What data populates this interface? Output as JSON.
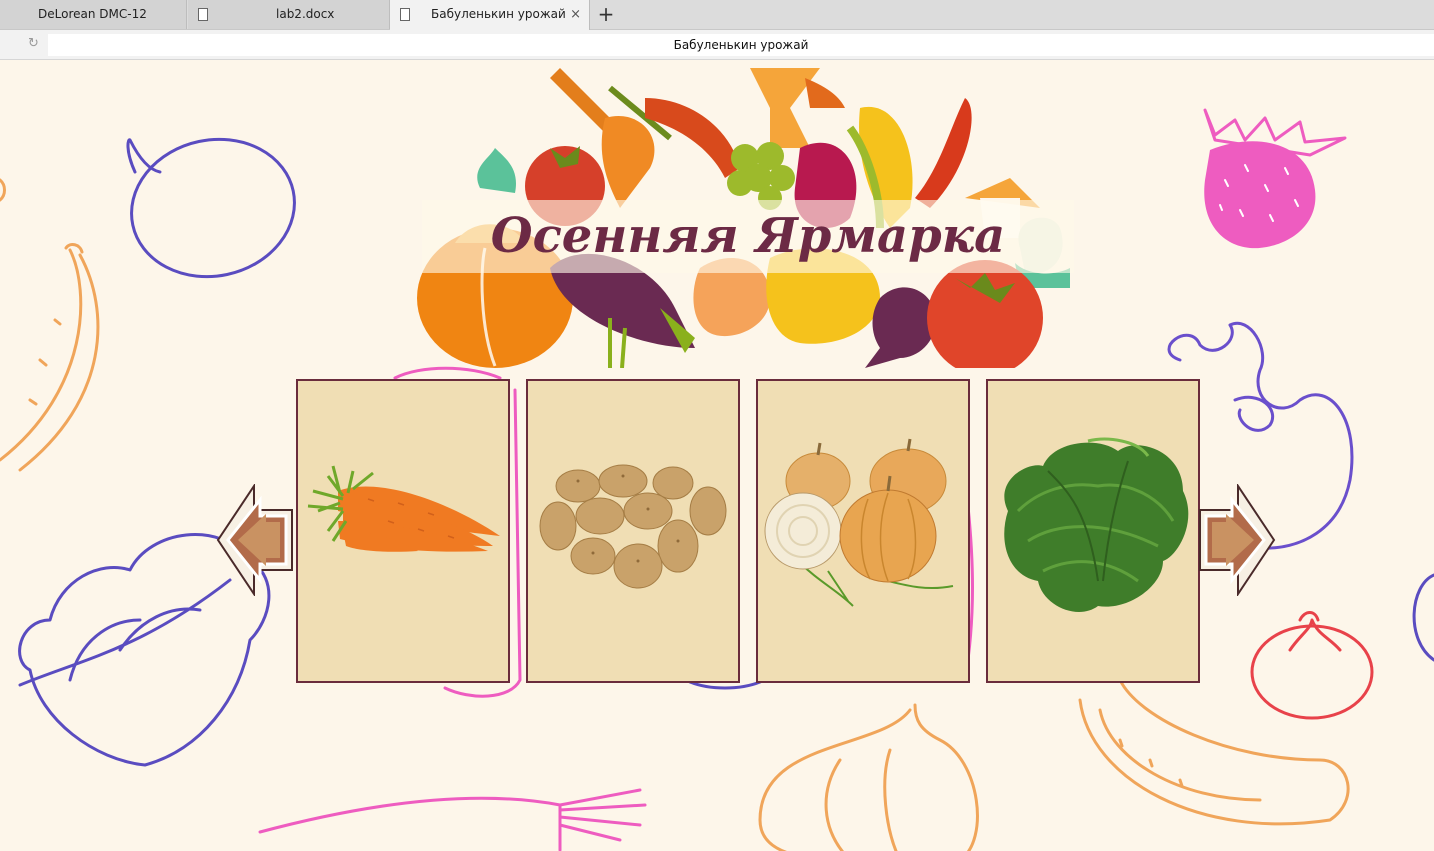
{
  "browser": {
    "tabs": [
      {
        "label": "DeLorean DMC-12",
        "active": false,
        "has_close": false
      },
      {
        "label": "lab2.docx",
        "active": false,
        "has_close": false
      },
      {
        "label": "Бабуленькин урожай",
        "active": true,
        "has_close": true
      }
    ],
    "close_glyph": "×",
    "new_tab_glyph": "+",
    "reload_glyph": "↻",
    "address": "Бабуленькин урожай"
  },
  "page": {
    "title": "Осенняя Ярмарка",
    "background_color": "#fdf6ea",
    "title_color": "#6c2a45",
    "card_color": "#f0deb4",
    "card_border_color": "#6a2c3c",
    "cards": [
      {
        "item": "carrot",
        "icon": "carrot-image"
      },
      {
        "item": "potato",
        "icon": "potato-image"
      },
      {
        "item": "onion",
        "icon": "onion-image"
      },
      {
        "item": "lettuce",
        "icon": "lettuce-image"
      }
    ],
    "nav": {
      "prev_icon": "arrow-left-icon",
      "next_icon": "arrow-right-icon"
    }
  }
}
